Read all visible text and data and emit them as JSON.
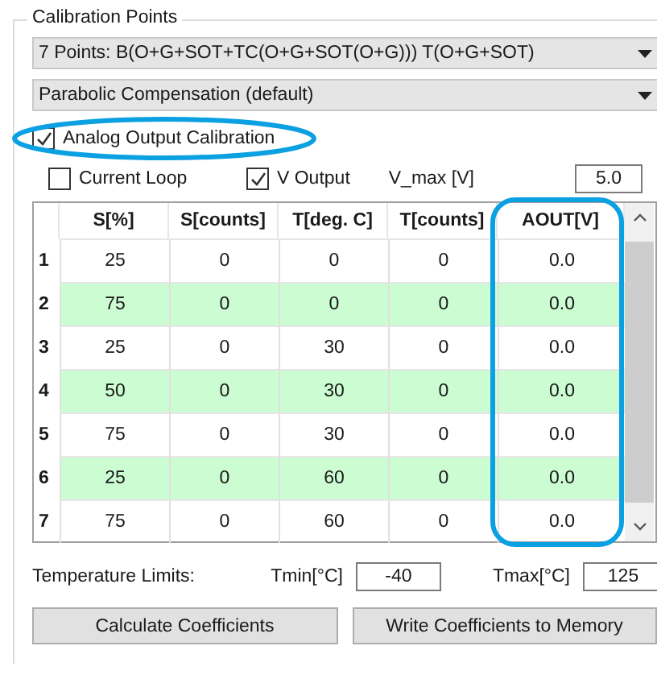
{
  "group_title": "Calibration Points",
  "dropdowns": [
    {
      "value": "7 Points: B(O+G+SOT+TC(O+G+SOT(O+G))) T(O+G+SOT)"
    },
    {
      "value": "Parabolic Compensation (default)"
    }
  ],
  "analog_output": {
    "label": "Analog Output Calibration",
    "checked": true
  },
  "options": [
    {
      "label": "Current Loop",
      "checked": false
    },
    {
      "label": "V Output",
      "checked": true
    }
  ],
  "vmax": {
    "label": "V_max [V]",
    "value": "5.0"
  },
  "table": {
    "columns": [
      "S[%]",
      "S[counts]",
      "T[deg. C]",
      "T[counts]",
      "AOUT[V]"
    ],
    "rows": [
      {
        "index": "1",
        "highlighted": false,
        "cells": [
          "25",
          "0",
          "0",
          "0",
          "0.0"
        ]
      },
      {
        "index": "2",
        "highlighted": true,
        "cells": [
          "75",
          "0",
          "0",
          "0",
          "0.0"
        ]
      },
      {
        "index": "3",
        "highlighted": false,
        "cells": [
          "25",
          "0",
          "30",
          "0",
          "0.0"
        ]
      },
      {
        "index": "4",
        "highlighted": true,
        "cells": [
          "50",
          "0",
          "30",
          "0",
          "0.0"
        ]
      },
      {
        "index": "5",
        "highlighted": false,
        "cells": [
          "75",
          "0",
          "30",
          "0",
          "0.0"
        ]
      },
      {
        "index": "6",
        "highlighted": true,
        "cells": [
          "25",
          "0",
          "60",
          "0",
          "0.0"
        ]
      },
      {
        "index": "7",
        "highlighted": false,
        "cells": [
          "75",
          "0",
          "60",
          "0",
          "0.0"
        ]
      }
    ]
  },
  "temperature_limits": {
    "label": "Temperature Limits:",
    "tmin_label": "Tmin[°C]",
    "tmin": "-40",
    "tmax_label": "Tmax[°C]",
    "tmax": "125"
  },
  "buttons": [
    "Calculate Coefficients",
    "Write Coefficients to Memory"
  ]
}
